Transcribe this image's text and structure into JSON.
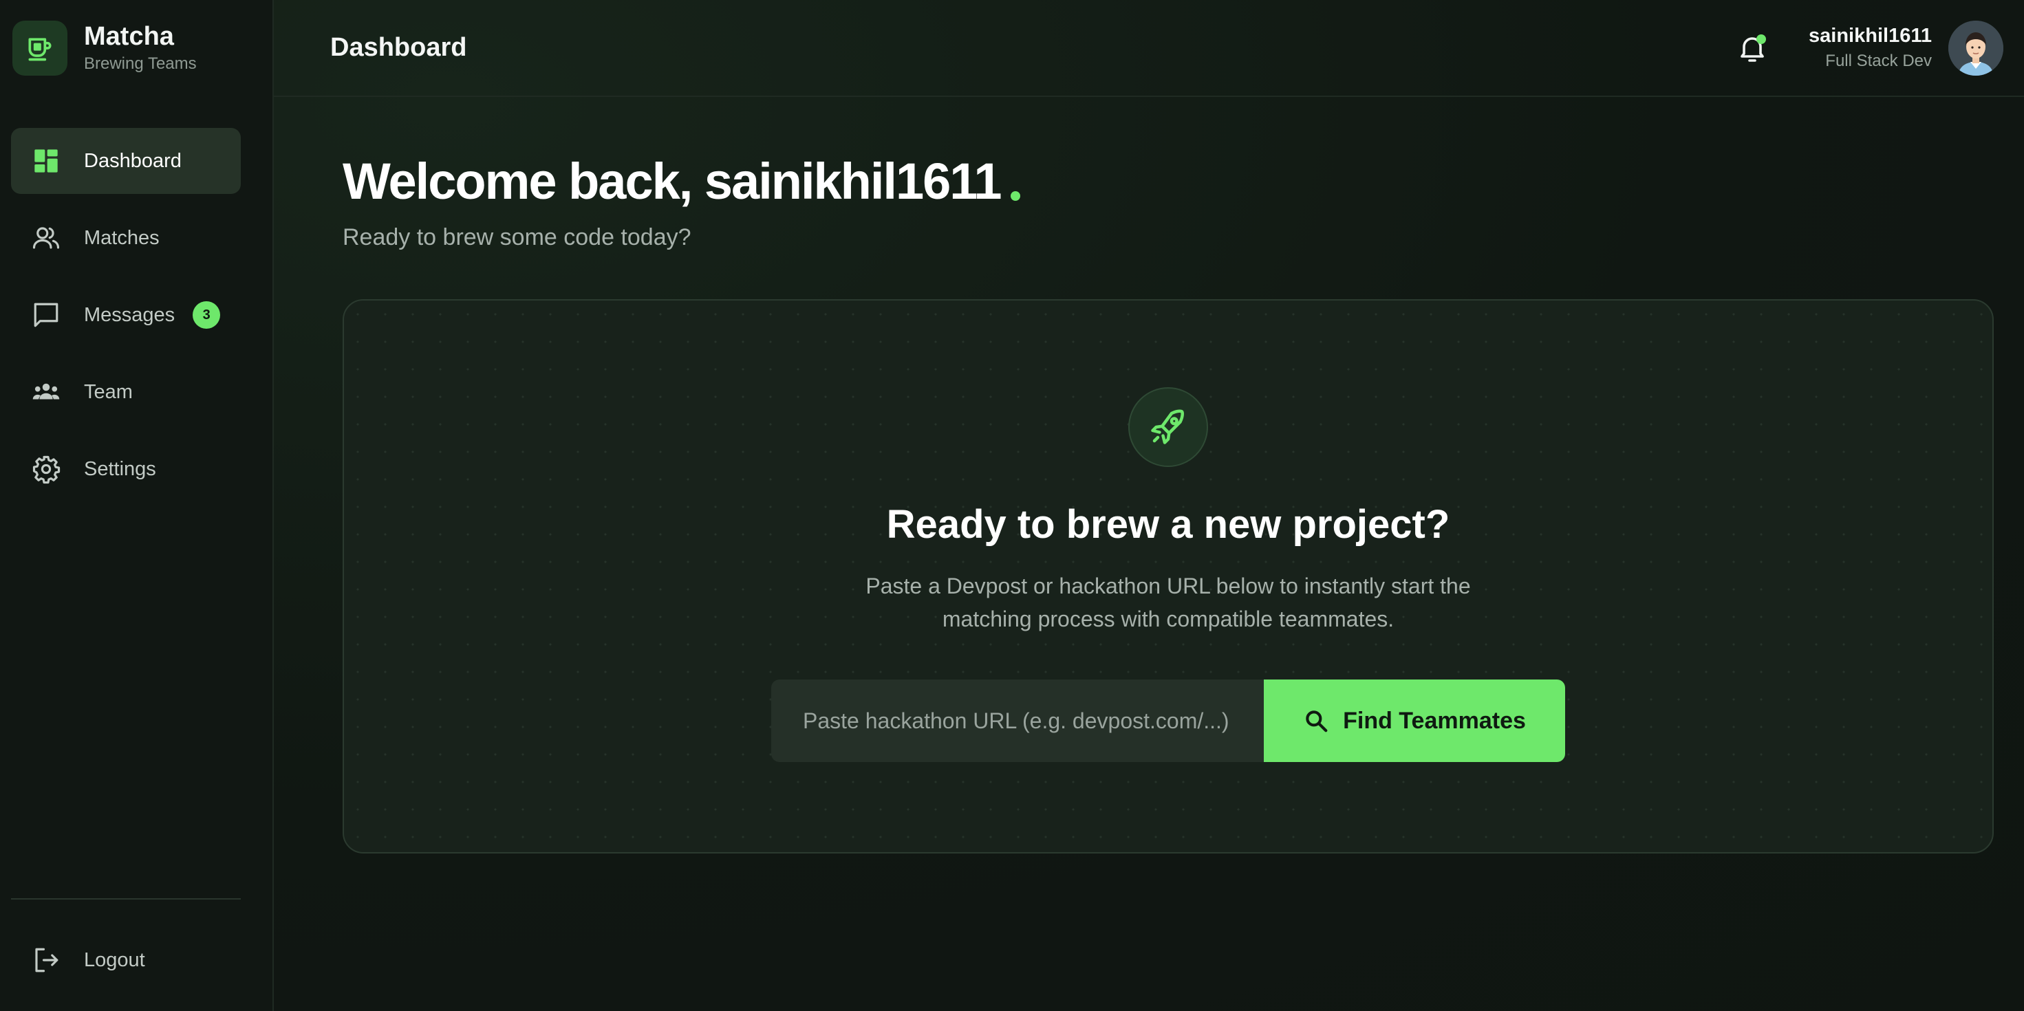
{
  "brand": {
    "name": "Matcha",
    "tagline": "Brewing Teams"
  },
  "sidebar": {
    "items": [
      {
        "label": "Dashboard",
        "icon": "dashboard-icon",
        "active": true
      },
      {
        "label": "Matches",
        "icon": "users-icon"
      },
      {
        "label": "Messages",
        "icon": "chat-icon",
        "badge": "3"
      },
      {
        "label": "Team",
        "icon": "team-icon"
      },
      {
        "label": "Settings",
        "icon": "gear-icon"
      }
    ],
    "logout_label": "Logout"
  },
  "header": {
    "title": "Dashboard",
    "user": {
      "name": "sainikhil1611",
      "role": "Full Stack Dev"
    }
  },
  "main": {
    "welcome": "Welcome back, sainikhil1611",
    "subtitle": "Ready to brew some code today?",
    "card": {
      "title": "Ready to brew a new project?",
      "description": "Paste a Devpost or hackathon URL below to instantly start the matching process with compatible teammates.",
      "input_placeholder": "Paste hackathon URL (e.g. devpost.com/...)",
      "button_label": "Find Teammates"
    }
  },
  "colors": {
    "accent": "#6ee86b",
    "background": "#0f1511",
    "card": "#18221b"
  }
}
